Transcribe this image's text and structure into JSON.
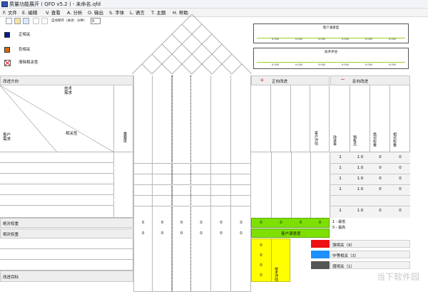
{
  "window": {
    "title": "质量功能展开 ( QFD  v5.2 ) - 未命名.qfd"
  },
  "menu": [
    "F. 文件",
    "E. 编辑",
    "V. 查看",
    "A. 分析",
    "O. 输出",
    "S. 字体",
    "L. 语言",
    "T. 主题",
    "H. 帮助"
  ],
  "toolbar": {
    "autosave_label": "自动保存（关闭：分钟）",
    "autosave_value": "0"
  },
  "legend": [
    {
      "label": "正相关",
      "color": "#0b1a8c"
    },
    {
      "label": "负相关",
      "color": "#d46a00"
    },
    {
      "label": "清除相关性",
      "color": "#e11111"
    }
  ],
  "panels": {
    "top": {
      "title": "客户满意度",
      "ticks": [
        "0.000",
        "0.000",
        "0.000",
        "0.000",
        "0.000",
        "0.000"
      ]
    },
    "bottom": {
      "title": "技术评估",
      "ticks": [
        "0.000",
        "0.000",
        "0.000",
        "0.000",
        "0.000",
        "0.000"
      ]
    }
  },
  "grid": {
    "improve_label": "改进方向",
    "plus_symbol": "+",
    "forward_label": "正向改进",
    "minus_symbol": "−",
    "reverse_label": "反向改进",
    "tech_req": "技术\n需求",
    "cust_req": "客户\n需求",
    "correlation": "相关性",
    "importance": "重要度",
    "customer_eval": "客户评估",
    "right_cols": [
      "改进率",
      "销售点",
      "绝对权重",
      "相对权重"
    ],
    "right_rows": [
      [
        "1",
        "1.0",
        "0",
        "0"
      ],
      [
        "1",
        "1.0",
        "0",
        "0"
      ],
      [
        "1",
        "1.0",
        "0",
        "0"
      ],
      [
        "1",
        "1.0",
        "0",
        "0"
      ],
      [
        "1",
        "1.0",
        "0",
        "0"
      ]
    ],
    "abs_weight": "绝对权重",
    "rel_weight": "相对权重",
    "target_label": "改进目标",
    "zero_row": [
      "0",
      "0",
      "0",
      "0",
      "0",
      "0"
    ],
    "green_row": [
      "0",
      "0",
      "0",
      "0"
    ],
    "satisfaction": "客户满意度",
    "scale_top": "1 - 最低",
    "scale_bottom": "5 - 最高",
    "yellow_vals": [
      "0",
      "0",
      "0",
      "0"
    ],
    "tech_eval_v": "技术评估",
    "rel_strong": "强相关（9）",
    "rel_medium": "中等相关（3）",
    "rel_weak": "弱相关（1）",
    "rel_colors": {
      "strong": "#ee1111",
      "medium": "#1e8fff",
      "weak": "#555555"
    }
  },
  "watermark": "当下软件园"
}
